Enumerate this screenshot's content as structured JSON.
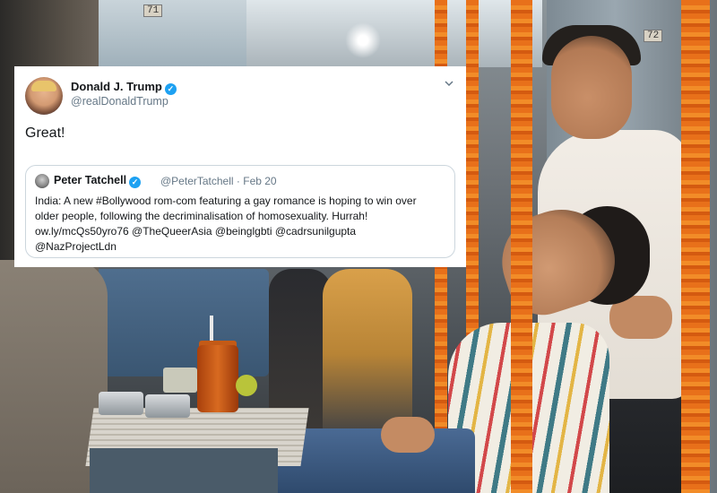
{
  "scene": {
    "seat_numbers": [
      "71",
      "72"
    ]
  },
  "tweet": {
    "author": {
      "name": "Donald J. Trump",
      "handle": "@realDonaldTrump",
      "verified_icon": "check"
    },
    "menu_icon": "chevron-down-icon",
    "text": "Great!",
    "quoted": {
      "name": "Peter Tatchell",
      "handle": "@PeterTatchell",
      "separator": "·",
      "date": "Feb 20",
      "lines": [
        "India: A new #Bollywood rom-com featuring a gay romance is hoping to win over",
        "older people, following the decriminalisation of homosexuality. Hurrah!",
        "ow.ly/mcQs50yro76 @TheQueerAsia @beinglgbti @cadrsunilgupta",
        "@NazProjectLdn"
      ]
    }
  },
  "colors": {
    "verified_blue": "#1da1f2",
    "text_primary": "#14171a",
    "text_secondary": "#657786",
    "border": "#ccd6dd",
    "marigold": "#e8701a"
  }
}
